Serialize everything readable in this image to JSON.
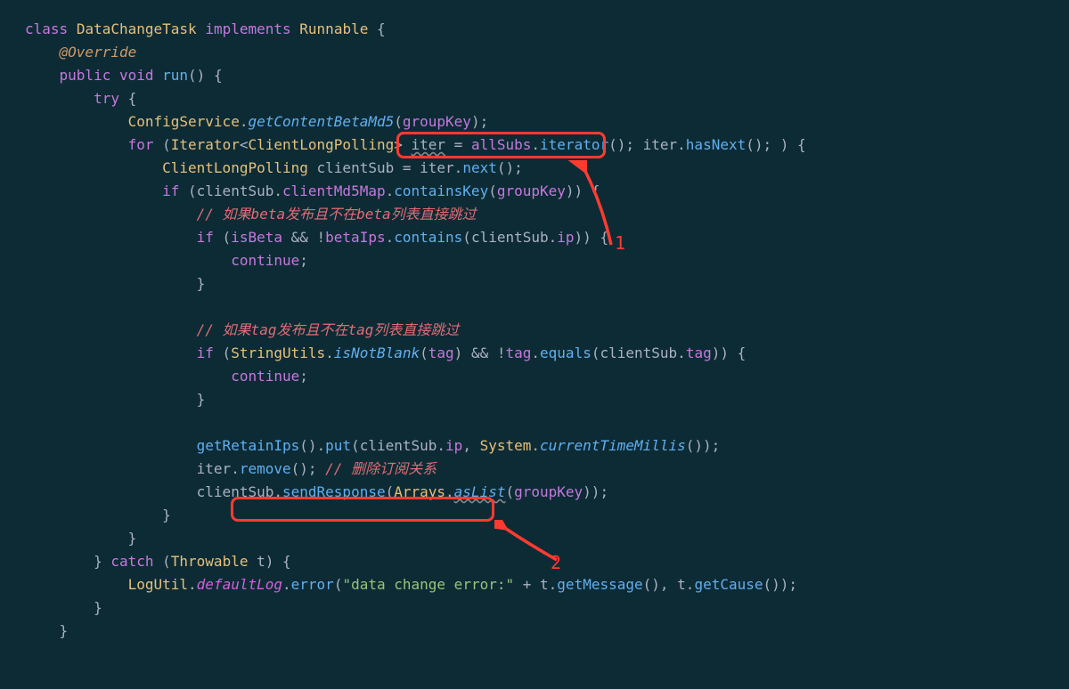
{
  "code": {
    "l1": {
      "kw_class": "class",
      "class_name": "DataChangeTask",
      "kw_impl": "implements",
      "iface": "Runnable",
      "brace": " {"
    },
    "l2": {
      "ann": "@Override"
    },
    "l3": {
      "mod": "public",
      "type": "void",
      "fn": "run",
      "paren": "()",
      "brace": " {"
    },
    "l4": {
      "kw": "try",
      "brace": " {"
    },
    "l5": {
      "cls": "ConfigService",
      "dot": ".",
      "fn": "getContentBetaMd5",
      "open": "(",
      "arg": "groupKey",
      "close": ");"
    },
    "l6": {
      "kw": "for",
      "open": " (",
      "type": "Iterator",
      "lt": "<",
      "gen": "ClientLongPolling",
      "gt": ">",
      "sp": " ",
      "iter": "iter",
      "eq": " = ",
      "field": "allSubs",
      "dot": ".",
      "fn": "iterator",
      "call": "()",
      "semi": "; ",
      "iter2": "iter",
      "dot2": ".",
      "fn2": "hasNext",
      "call2": "();",
      "sp2": " ) {"
    },
    "l7": {
      "type": "ClientLongPolling",
      "sp": " ",
      "var": "clientSub",
      "eq": " = ",
      "iter": "iter",
      "dot": ".",
      "fn": "next",
      "call": "();"
    },
    "l8": {
      "kw": "if",
      "open": " (",
      "var": "clientSub",
      "dot": ".",
      "field": "clientMd5Map",
      "dot2": ".",
      "fn": "containsKey",
      "paren": "(",
      "arg": "groupKey",
      "close": ")) {"
    },
    "l9": {
      "comment": "// 如果beta发布且不在beta列表直接跳过"
    },
    "l10": {
      "kw": "if",
      "open": " (",
      "var": "isBeta",
      "and": " && !",
      "field": "betaIps",
      "dot": ".",
      "fn": "contains",
      "paren": "(",
      "var2": "clientSub",
      "dot2": ".",
      "field2": "ip",
      "close": ")) {"
    },
    "l11": {
      "kw": "continue",
      "semi": ";"
    },
    "l12": {
      "brace": "}"
    },
    "l14": {
      "comment": "// 如果tag发布且不在tag列表直接跳过"
    },
    "l15": {
      "kw": "if",
      "open": " (",
      "cls": "StringUtils",
      "dot": ".",
      "fn": "isNotBlank",
      "paren": "(",
      "arg": "tag",
      "close": ")",
      "and": " && !",
      "var": "tag",
      "dot2": ".",
      "fn2": "equals",
      "paren2": "(",
      "var2": "clientSub",
      "dot3": ".",
      "field": "tag",
      "close2": ")) {"
    },
    "l16": {
      "kw": "continue",
      "semi": ";"
    },
    "l17": {
      "brace": "}"
    },
    "l19": {
      "fn": "getRetainIps",
      "call": "().",
      "fn2": "put",
      "open": "(",
      "var": "clientSub",
      "dot": ".",
      "field": "ip",
      "comma": ", ",
      "cls": "System",
      "dot2": ".",
      "fn3": "currentTimeMillis",
      "call2": "());"
    },
    "l20": {
      "var": "iter",
      "dot": ".",
      "fn": "remove",
      "call": "();",
      "sp": " ",
      "comment": "// 删除订阅关系"
    },
    "l21": {
      "var": "clientSub",
      "dot": ".",
      "fn": "sendResponse",
      "open": "(",
      "cls": "Arrays",
      "dot2": ".",
      "fn2": "asList",
      "paren": "(",
      "arg": "groupKey",
      "close": "));"
    },
    "l22": {
      "brace": "}"
    },
    "l23": {
      "brace": "}"
    },
    "l24": {
      "brace": "}",
      "kw": " catch",
      "open": " (",
      "type": "Throwable",
      "sp": " ",
      "var": "t",
      "close": ") {"
    },
    "l25": {
      "cls": "LogUtil",
      "dot": ".",
      "field": "defaultLog",
      "dot2": ".",
      "fn": "error",
      "open": "(",
      "str": "\"data change error:\"",
      "plus": " + ",
      "var": "t",
      "dot3": ".",
      "fn2": "getMessage",
      "call": "(), ",
      "var2": "t",
      "dot4": ".",
      "fn3": "getCause",
      "call2": "());"
    },
    "l26": {
      "brace": "}"
    },
    "l27": {
      "brace": "}"
    }
  },
  "annotation": {
    "label1": "1",
    "label2": "2"
  }
}
